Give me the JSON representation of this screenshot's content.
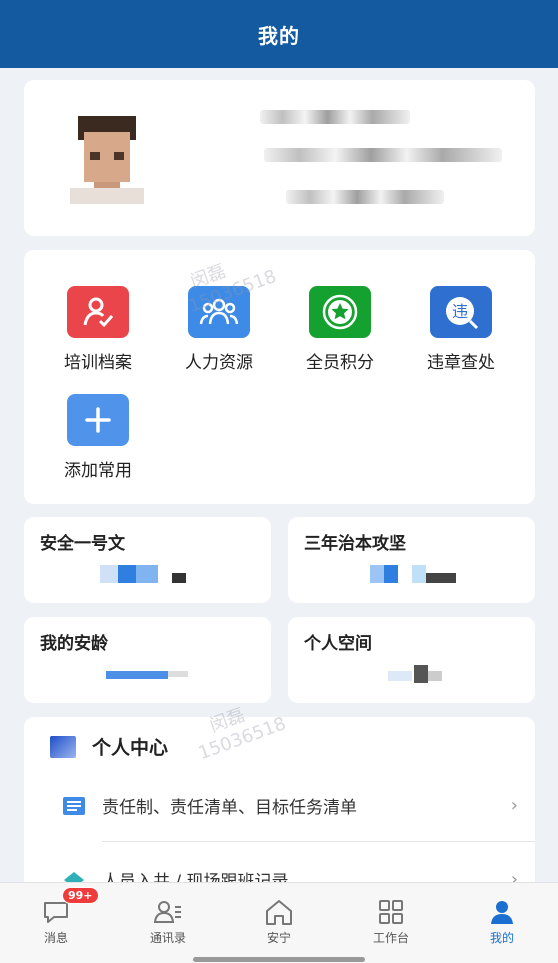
{
  "header": {
    "title": "我的"
  },
  "apps": [
    {
      "label": "培训档案",
      "icon": "training-record-icon",
      "color": "#e9454a"
    },
    {
      "label": "人力资源",
      "icon": "people-icon",
      "color": "#3d8be6"
    },
    {
      "label": "全员积分",
      "icon": "star-badge-icon",
      "color": "#15a12f"
    },
    {
      "label": "违章查处",
      "icon": "violation-search-icon",
      "color": "#2f6fd0"
    },
    {
      "label": "添加常用",
      "icon": "plus-icon",
      "color": "#4f93ea"
    }
  ],
  "watermark": {
    "name": "闵磊",
    "number": "15036518"
  },
  "tiles": [
    {
      "title": "安全一号文"
    },
    {
      "title": "三年治本攻坚"
    },
    {
      "title": "我的安龄"
    },
    {
      "title": "个人空间"
    }
  ],
  "personal_center": {
    "title": "个人中心",
    "items": [
      {
        "label": "责任制、责任清单、目标任务清单"
      },
      {
        "label": "人员入井 / 现场跟班记录"
      }
    ]
  },
  "tabbar": {
    "items": [
      {
        "label": "消息",
        "icon": "message-icon",
        "badge": "99+"
      },
      {
        "label": "通讯录",
        "icon": "contacts-icon"
      },
      {
        "label": "安宁",
        "icon": "home-icon"
      },
      {
        "label": "工作台",
        "icon": "grid-icon"
      },
      {
        "label": "我的",
        "icon": "person-icon",
        "active": true
      }
    ]
  },
  "colors": {
    "header": "#145aa0",
    "active_tab": "#1a6fd0",
    "badge": "#ef3b3b"
  }
}
